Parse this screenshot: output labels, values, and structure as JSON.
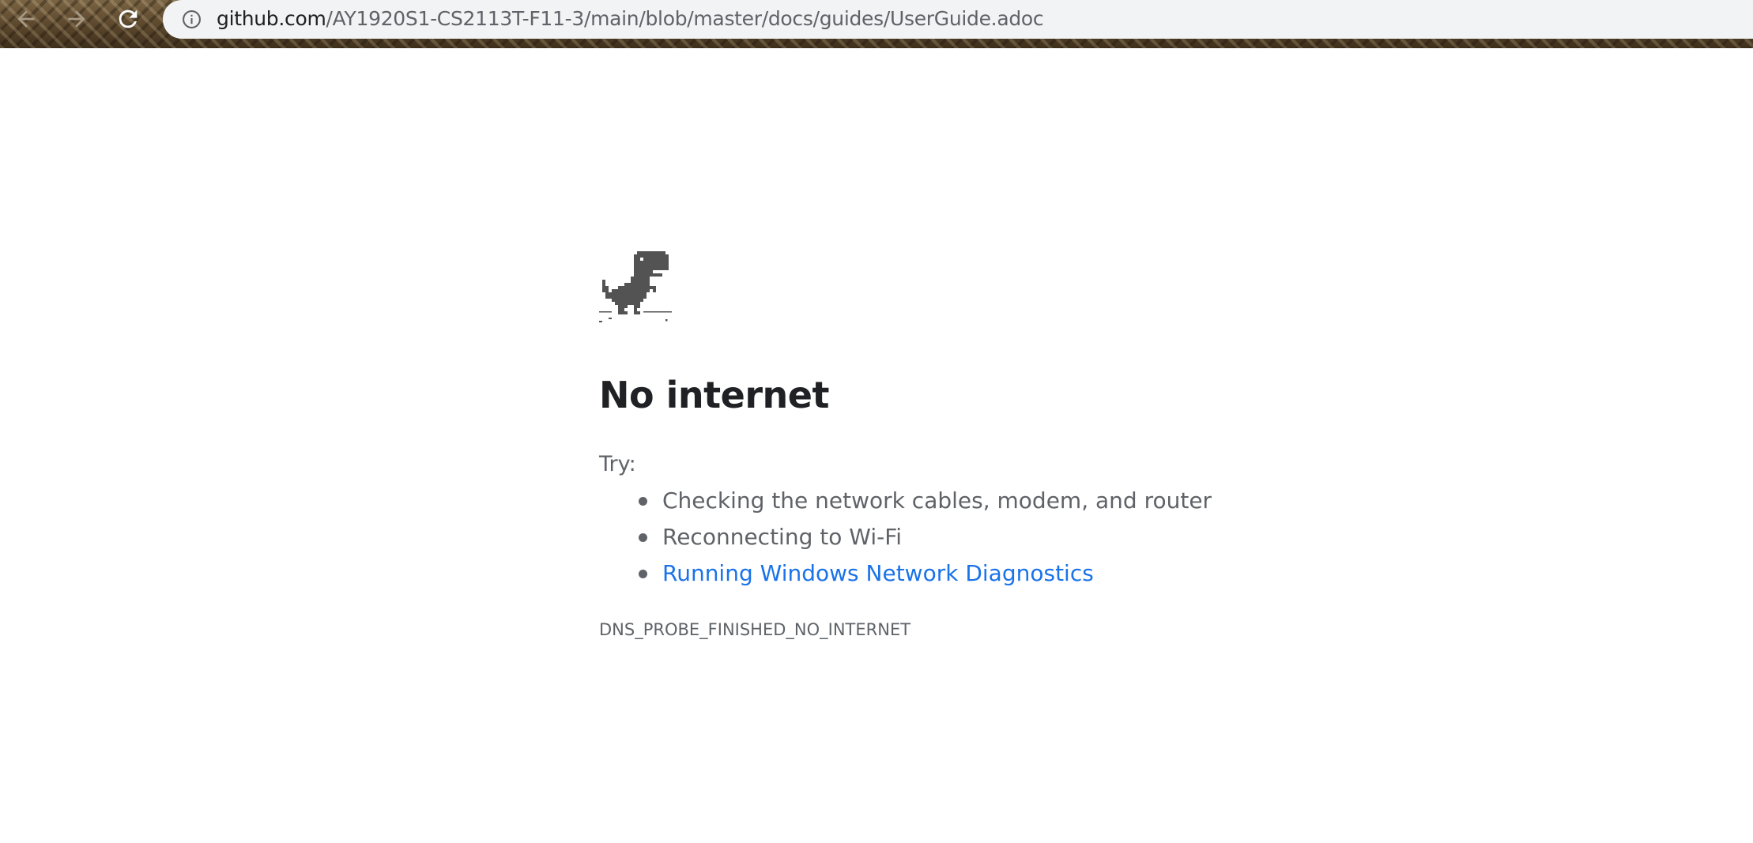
{
  "browser": {
    "url_host": "github.com",
    "url_path": "/AY1920S1-CS2113T-F11-3/main/blob/master/docs/guides/UserGuide.adoc",
    "icons": {
      "back": "arrow-left-icon",
      "forward": "arrow-right-icon",
      "reload": "reload-icon",
      "site_info": "info-icon"
    }
  },
  "error_page": {
    "heading": "No internet",
    "try_label": "Try:",
    "suggestions": [
      {
        "text": "Checking the network cables, modem, and router",
        "link": false
      },
      {
        "text": "Reconnecting to Wi-Fi",
        "link": false
      },
      {
        "text": "Running Windows Network Diagnostics",
        "link": true
      }
    ],
    "error_code": "DNS_PROBE_FINISHED_NO_INTERNET",
    "illustration": "offline-dino-icon"
  },
  "colors": {
    "heading": "#202124",
    "body_text": "#5f6368",
    "link": "#1a73e8",
    "omnibox": "#f1f3f4"
  }
}
